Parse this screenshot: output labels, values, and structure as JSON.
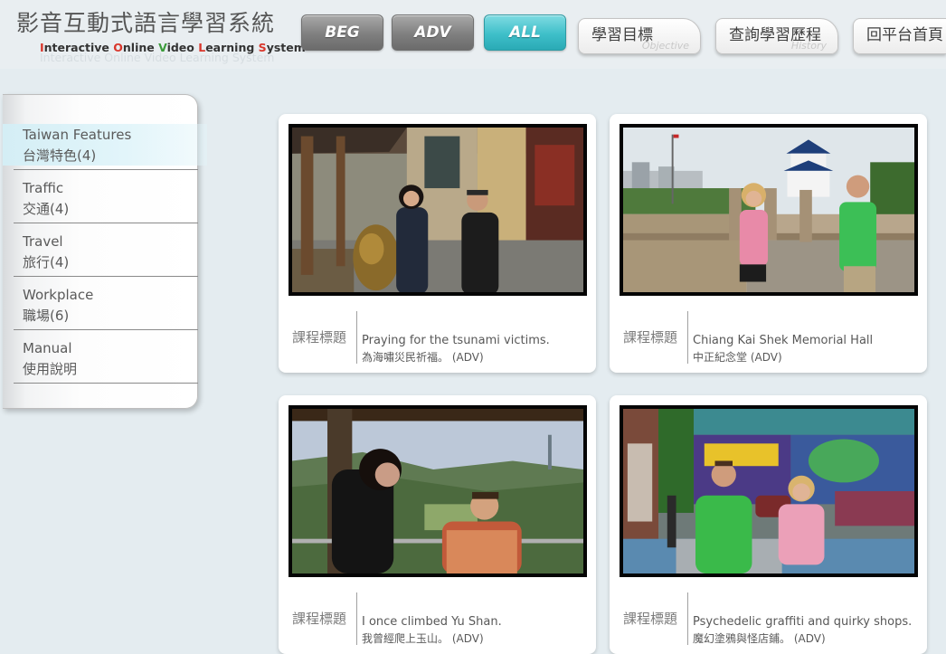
{
  "header": {
    "title": "影音互動式語言學習系統",
    "subtitle": {
      "word1_initial": "I",
      "word1_rest": "nteractive ",
      "word2_initial": "O",
      "word2_rest": "nline ",
      "word3_initial": "V",
      "word3_rest": "ideo ",
      "word4_initial": "L",
      "word4_rest": "earning ",
      "word5_initial": "S",
      "word5_rest": "ystem",
      "full": "Interactive Online Video Learning System"
    },
    "level_buttons": [
      {
        "label": "BEG"
      },
      {
        "label": "ADV"
      },
      {
        "label": "ALL"
      }
    ],
    "tabs": [
      {
        "label": "學習目標",
        "ghost": "Objective"
      },
      {
        "label": "查詢學習歷程",
        "ghost": "History"
      },
      {
        "label": "回平台首頁"
      }
    ]
  },
  "sidebar": {
    "items": [
      {
        "en": "Taiwan Features",
        "zh": "台灣特色(4)"
      },
      {
        "en": "Traffic",
        "zh": "交通(4)"
      },
      {
        "en": "Travel",
        "zh": "旅行(4)"
      },
      {
        "en": "Workplace",
        "zh": "職場(6)"
      },
      {
        "en": "Manual",
        "zh": "使用說明"
      }
    ]
  },
  "cards": [
    {
      "label": "課程標題",
      "title_en": "Praying for the tsunami victims.",
      "title_zh": "為海嘯災民祈福。 (ADV)"
    },
    {
      "label": "課程標題",
      "title_en": "Chiang Kai Shek Memorial Hall",
      "title_zh": "中正紀念堂 (ADV)"
    },
    {
      "label": "課程標題",
      "title_en": "I once climbed Yu Shan.",
      "title_zh": "我曾經爬上玉山。 (ADV)"
    },
    {
      "label": "課程標題",
      "title_en": "Psychedelic graffiti and quirky shops.",
      "title_zh": "魔幻塗鴉與怪店鋪。 (ADV)"
    }
  ],
  "colors": {
    "accent_active": "#3ebfc9",
    "level_inactive": "#7f7f7f",
    "logo_red": "#d9362b",
    "logo_green": "#3b9b3b",
    "background": "#e4ecf0"
  }
}
